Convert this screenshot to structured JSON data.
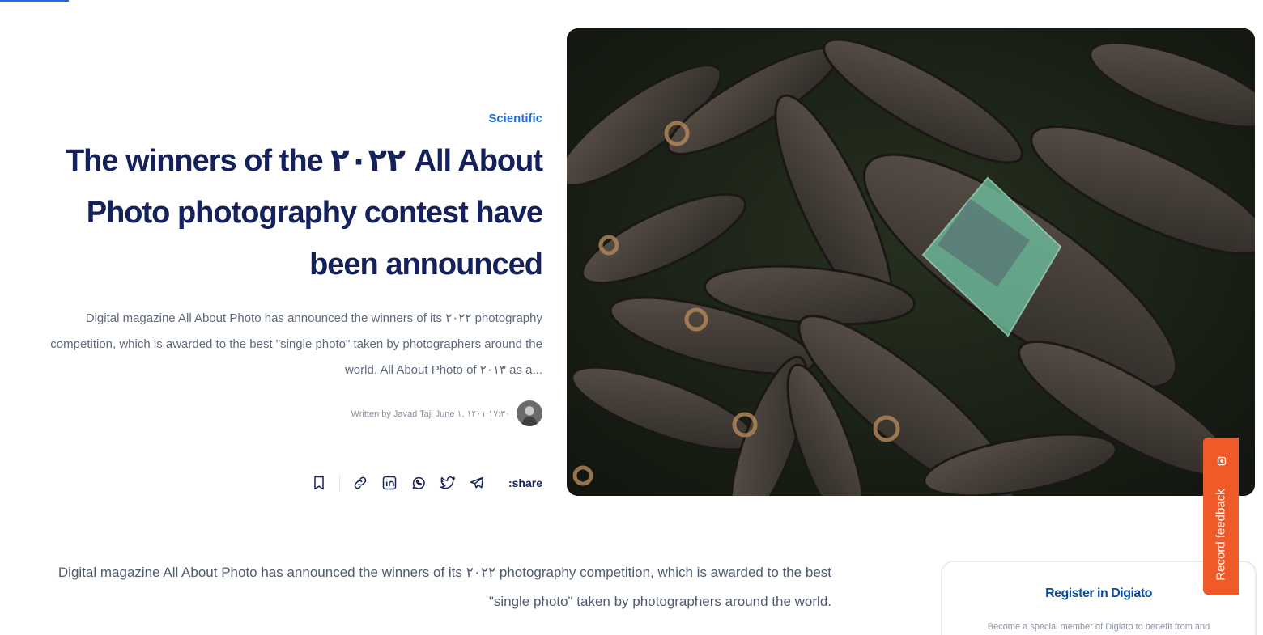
{
  "article": {
    "category": "Scientific",
    "title": "The winners of the ۲۰۲۲ All About Photo photography contest have been announced",
    "excerpt": "Digital magazine All About Photo has announced the winners of its ۲۰۲۲ photography competition, which is awarded to the best \"single photo\" taken by photographers around the world. All About Photo of ۲۰۱۳ as a...",
    "byline": "Written by Javad Taji June ۱, ۱۴۰۱ ۱۷:۳۰",
    "share_label": ":share",
    "body_paragraph": "Digital magazine All About Photo has announced the winners of its ۲۰۲۲ photography competition, which is awarded to the best \"single photo\" taken by photographers around the world."
  },
  "share_icons": [
    "telegram-icon",
    "twitter-icon",
    "whatsapp-icon",
    "linkedin-icon",
    "copy-link-icon",
    "bookmark-icon"
  ],
  "sidebar": {
    "register_title": "Register in Digiato",
    "register_text": "Become a special member of Digiato to benefit from and"
  },
  "feedback": {
    "label": "Record feedback"
  },
  "colors": {
    "accent": "#1e6fd6",
    "title": "#15215a",
    "feedback": "#f05a28"
  }
}
